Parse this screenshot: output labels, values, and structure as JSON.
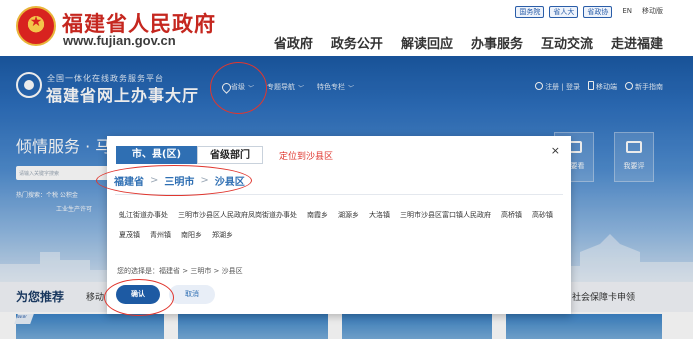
{
  "gov": {
    "title": "福建省人民政府",
    "url": "www.fujian.gov.cn",
    "util_tags": [
      "国务院",
      "省人大",
      "省政协"
    ],
    "util_plain": [
      "EN",
      "移动版"
    ],
    "nav": [
      "省政府",
      "政务公开",
      "解读回应",
      "办事服务",
      "互动交流",
      "走进福建"
    ]
  },
  "portal": {
    "subtitle": "全国一体化在线政务服务平台",
    "title": "福建省网上办事大厅",
    "region_label": "省级",
    "nav": [
      "专题导航",
      "特色专栏"
    ],
    "register_login": "注册 | 登录",
    "mobile": "移动端",
    "guide": "新手指南",
    "heading": "倾情服务 · 马",
    "search_placeholder": "请输入关键字搜索",
    "hot_line1": "热门搜索：个税  公积金",
    "hot_line2": "工业生产许可",
    "quick": [
      "我要看",
      "我要评"
    ]
  },
  "recommend": {
    "title": "为您推荐",
    "sub": "移动",
    "right_item": "社会保障卡申领",
    "new_badge": "NEW"
  },
  "modal": {
    "tab_active": "市、县(区)",
    "tab_inactive": "省级部门",
    "locate_hint": "定位到沙县区",
    "breadcrumb": [
      "福建省",
      "三明市",
      "沙县区"
    ],
    "crumb_sep": ">",
    "close": "×",
    "options": [
      "虬江街道办事处",
      "三明市沙县区人民政府凤岗街道办事处",
      "南霞乡",
      "湖源乡",
      "大洛镇",
      "三明市沙县区富口镇人民政府",
      "高桥镇",
      "高砂镇",
      "夏茂镇",
      "青州镇",
      "南阳乡",
      "郑湖乡"
    ],
    "choice_text": "您的选择是：福建省 > 三明市 > 沙县区",
    "confirm": "确认",
    "cancel": "取消"
  },
  "colors": {
    "brand_red": "#c5271f",
    "portal_blue": "#2f6fb3",
    "annotation_red": "#e0372f",
    "confirm_blue": "#1d5aa3"
  }
}
